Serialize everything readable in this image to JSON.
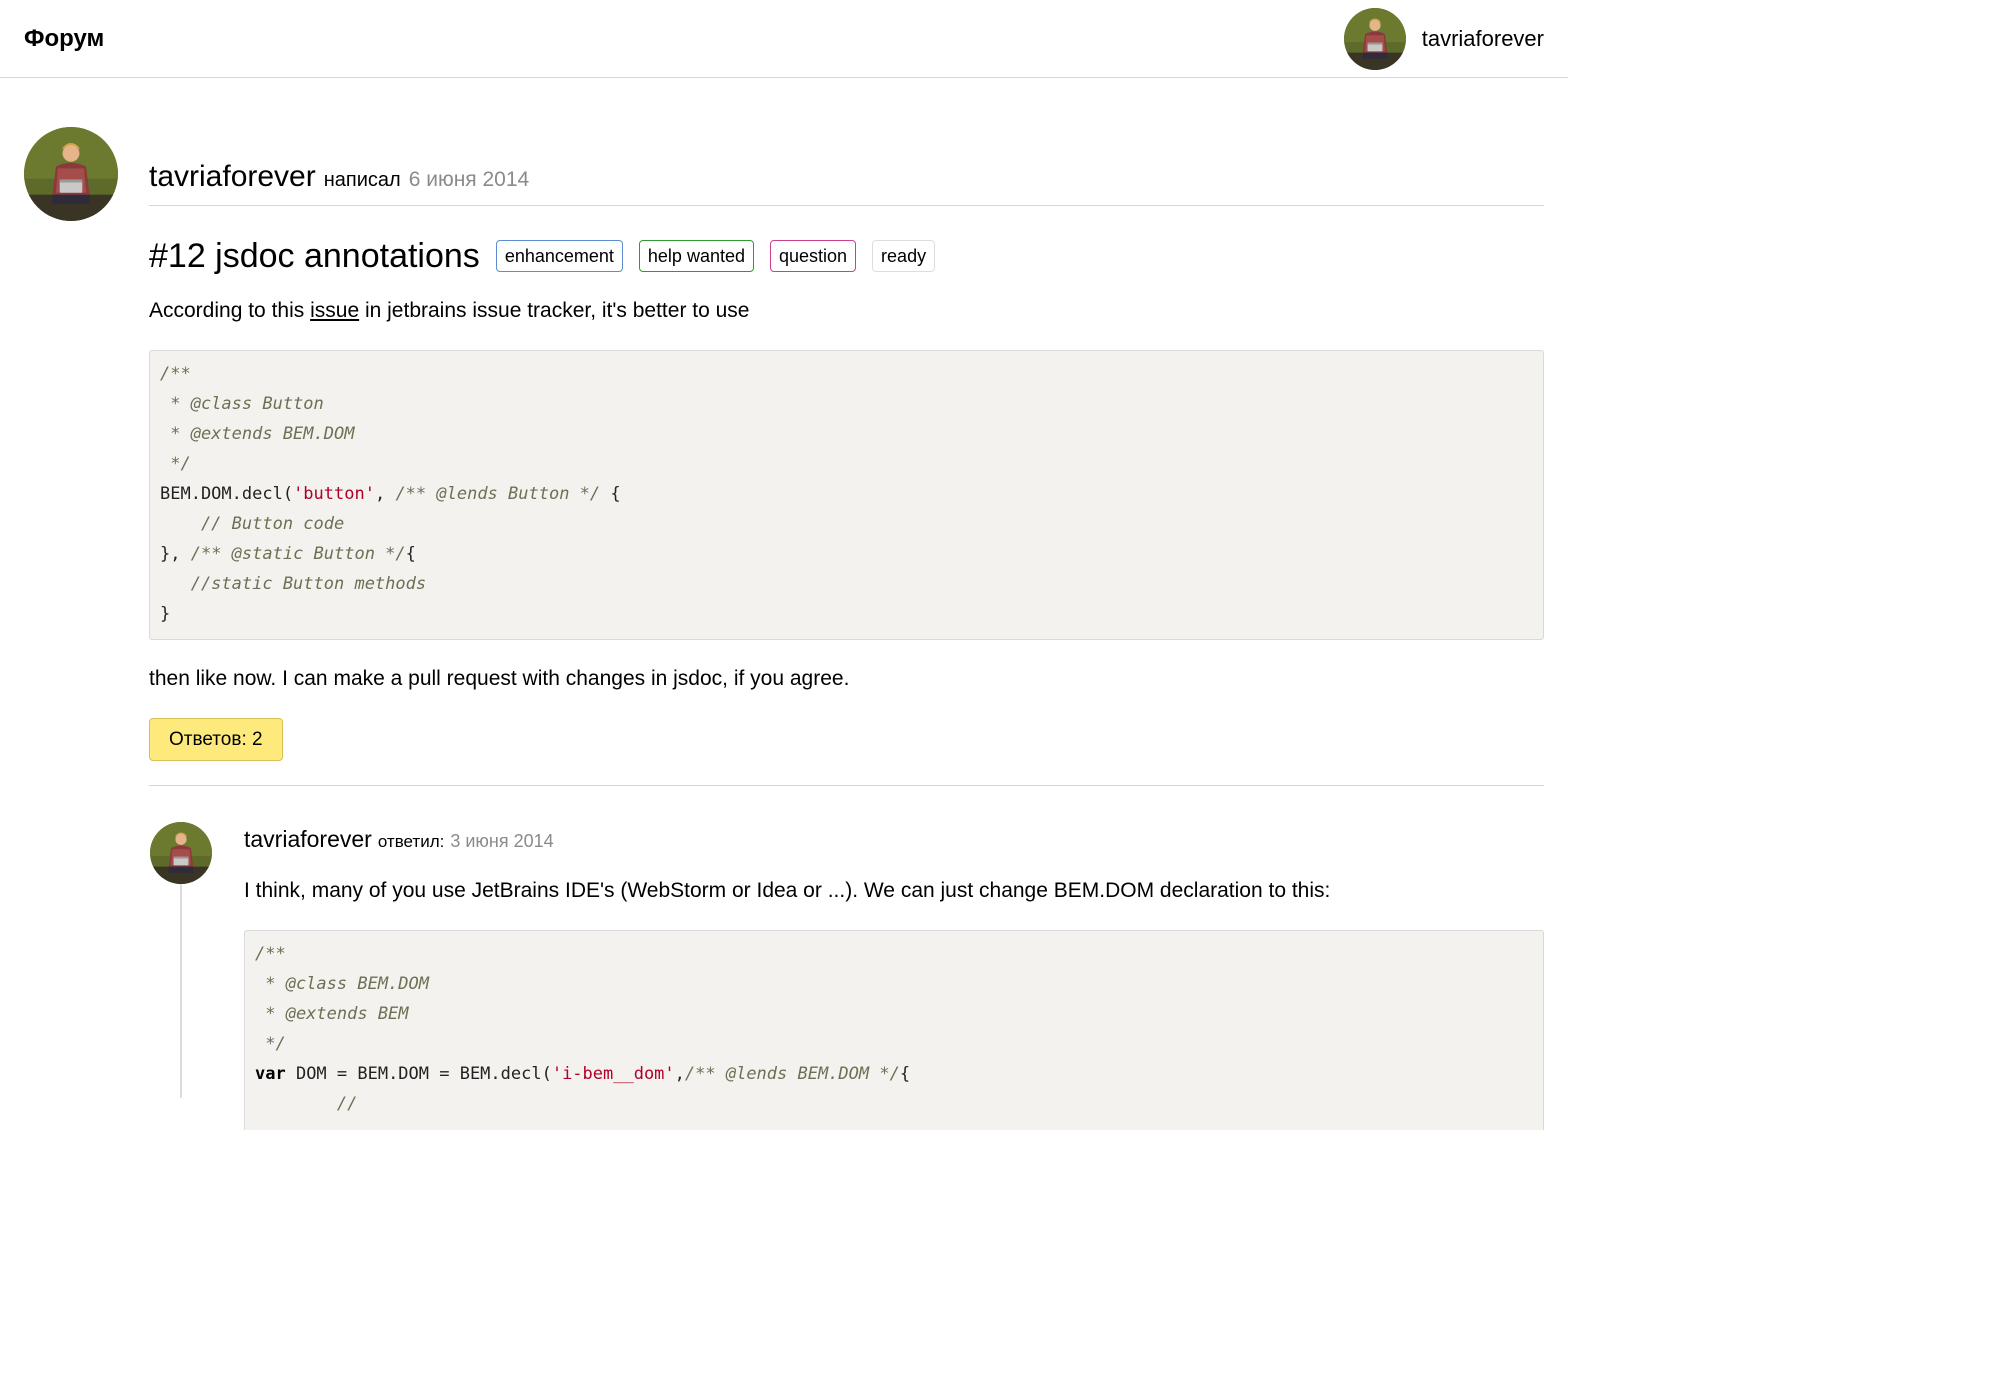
{
  "header": {
    "title": "Форум",
    "user_name": "tavriaforever"
  },
  "post": {
    "author": "tavriaforever",
    "verb": "написал",
    "date": "6 июня 2014",
    "title": "#12 jsdoc annotations",
    "labels": [
      {
        "text": "enhancement",
        "color": "#5b8ed0"
      },
      {
        "text": "help wanted",
        "color": "#2f9a2f"
      },
      {
        "text": "question",
        "color": "#cc3f8f"
      },
      {
        "text": "ready",
        "color": "#dddddd"
      }
    ],
    "intro_before": "According to this ",
    "intro_link": "issue",
    "intro_after": " in jetbrains issue tracker, it's better to use",
    "code": {
      "line1": "/**",
      "line2": " * @class Button",
      "line3": " * @extends BEM.DOM",
      "line4": " */",
      "line5_a": "BEM.DOM.decl(",
      "line5_s": "'button'",
      "line5_b": ", ",
      "line5_c": "/** @lends Button */",
      "line5_d": " {",
      "line6": "    // Button code",
      "line7_a": "}, ",
      "line7_c": "/** @static Button */",
      "line7_d": "{",
      "line8": "   //static Button methods",
      "line9": "}"
    },
    "outro": "then like now. I can make a pull request with changes in jsdoc, if you agree.",
    "replies_button": "Ответов: 2"
  },
  "reply": {
    "author": "tavriaforever",
    "verb": "ответил:",
    "date": "3 июня 2014",
    "text": "I think, many of you use JetBrains IDE's (WebStorm or Idea or ...). We can just change BEM.DOM declaration to this:",
    "code": {
      "line1": "/**",
      "line2": " * @class BEM.DOM",
      "line3": " * @extends BEM",
      "line4": " */",
      "line5_k": "var",
      "line5_a": " DOM = BEM.DOM = BEM.decl(",
      "line5_s": "'i-bem__dom'",
      "line5_b": ",",
      "line5_c": "/** @lends BEM.DOM */",
      "line5_d": "{"
    }
  },
  "colors": {
    "replies_button_bg": "#fde97c",
    "code_bg": "#f3f2ee",
    "string": "#b0002a",
    "comment": "#6f6f55",
    "muted_text": "#8a8a8a"
  }
}
